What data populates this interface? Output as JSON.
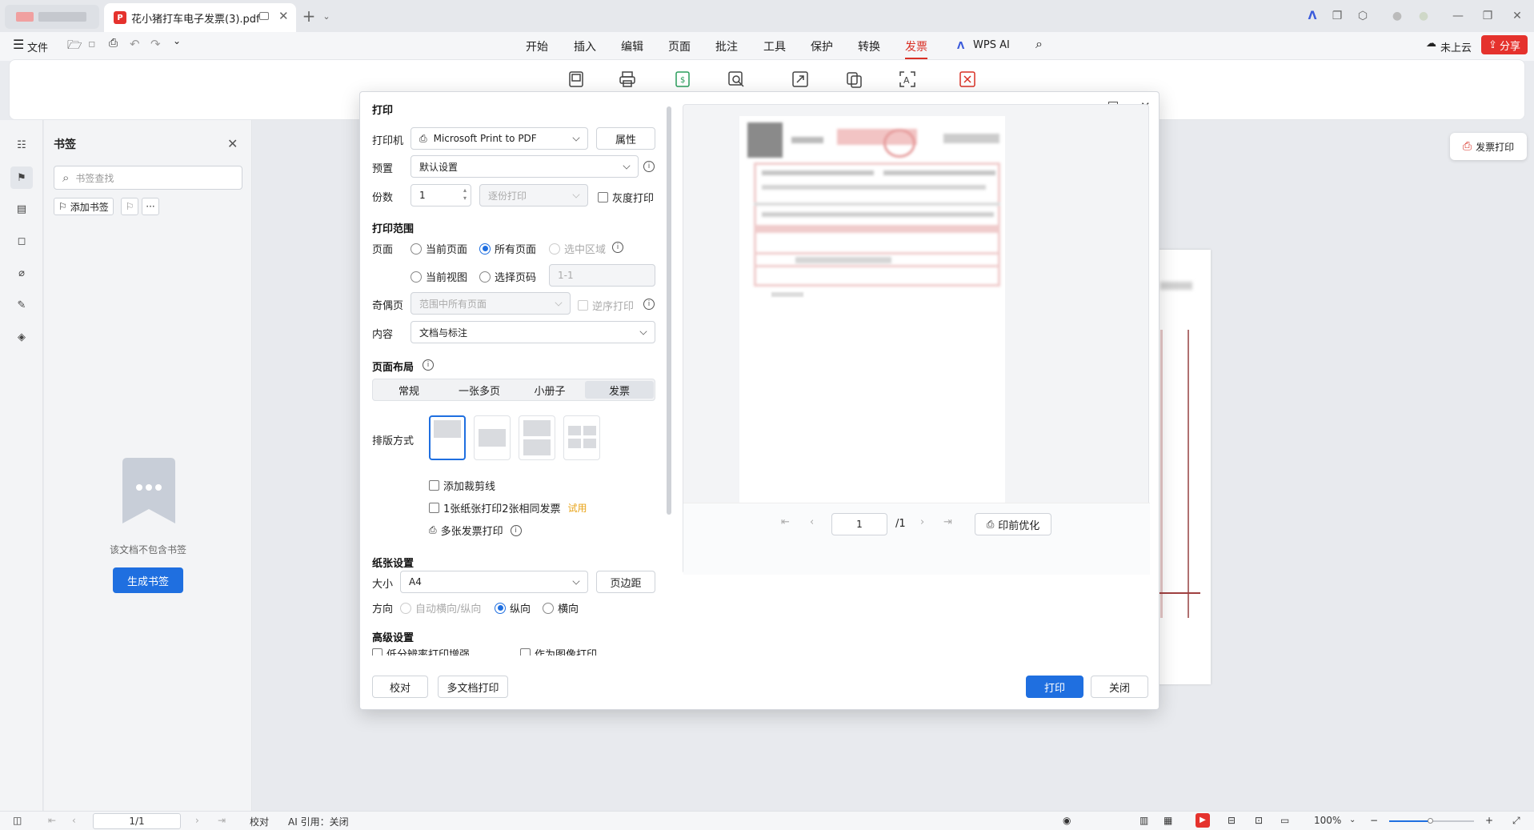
{
  "titlebar": {
    "doc_tab_title": "花小猪打车电子发票(3).pdf",
    "new_tab": "+"
  },
  "menubar": {
    "file_label": "文件",
    "tabs": [
      "开始",
      "插入",
      "编辑",
      "页面",
      "批注",
      "工具",
      "保护",
      "转换",
      "发票"
    ],
    "active_tab": "发票",
    "wps_ai": "WPS AI",
    "cloud_status": "未上云",
    "share": "分享"
  },
  "bookmark_panel": {
    "title": "书签",
    "search_placeholder": "书签查找",
    "add_bookmark": "添加书签",
    "more": "···",
    "empty_text": "该文档不包含书签",
    "generate_button": "生成书签"
  },
  "invoice_print_button": "发票打印",
  "status_bar": {
    "page": "1/1",
    "proofread": "校对",
    "ai_cite": "AI 引用：关闭",
    "zoom": "100%"
  },
  "print_dialog": {
    "title": "打印",
    "printer_label": "打印机",
    "printer_value": "Microsoft Print to PDF",
    "properties_button": "属性",
    "preset_label": "预置",
    "preset_value": "默认设置",
    "copies_label": "份数",
    "copies_value": "1",
    "collate_value": "逐份打印",
    "grayscale": "灰度打印",
    "range_heading": "打印范围",
    "page_label": "页面",
    "range_options": [
      "当前页面",
      "所有页面",
      "选中区域",
      "当前视图",
      "选择页码"
    ],
    "selected_range": "所有页面",
    "page_range_placeholder": "1-1",
    "odd_even_label": "奇偶页",
    "odd_even_value": "范围中所有页面",
    "reverse_print": "逆序打印",
    "content_label": "内容",
    "content_value": "文档与标注",
    "layout_heading": "页面布局",
    "layout_tabs": [
      "常规",
      "一张多页",
      "小册子",
      "发票"
    ],
    "layout_active": "发票",
    "arrange_label": "排版方式",
    "add_crop_marks": "添加裁剪线",
    "two_per_sheet": "1张纸张打印2张相同发票",
    "trial_badge": "试用",
    "multi_invoice": "多张发票打印",
    "paper_heading": "纸张设置",
    "size_label": "大小",
    "size_value": "A4",
    "margins_button": "页边距",
    "orientation_label": "方向",
    "orientation_options": [
      "自动横向/纵向",
      "纵向",
      "横向"
    ],
    "orientation_selected": "纵向",
    "advanced_heading": "高级设置",
    "advanced_options": [
      "低分辨率打印增强",
      "作为图像打印"
    ],
    "proof_button": "校对",
    "multi_doc_button": "多文档打印",
    "print_button": "打印",
    "close_button": "关闭",
    "preview_page": "1",
    "preview_total": "/1",
    "pre_optimize": "印前优化"
  },
  "colors": {
    "accent": "#1f6fe0",
    "brand_red": "#e5322d",
    "active_tab": "#d93025",
    "trial": "#e8a317"
  }
}
